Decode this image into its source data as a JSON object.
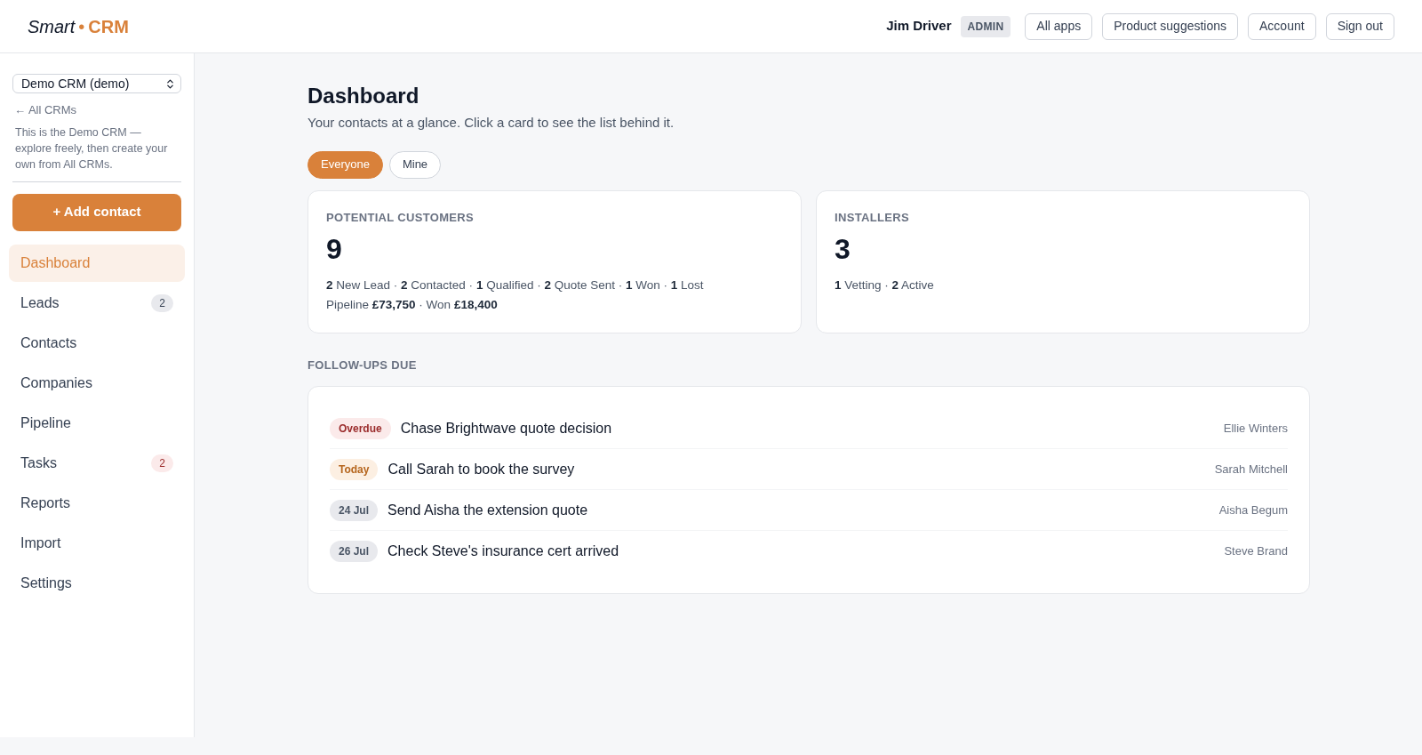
{
  "header": {
    "logo": {
      "prefix": "Smart",
      "separator": "•",
      "suffix": "CRM"
    },
    "user_name": "Jim Driver",
    "role_badge": "ADMIN",
    "buttons": [
      "All apps",
      "Product suggestions",
      "Account",
      "Sign out"
    ]
  },
  "sidebar": {
    "crm_select": {
      "value": "Demo CRM (demo)"
    },
    "back_link": "← All CRMs",
    "note": "This is the Demo CRM — explore freely, then create your own from All CRMs.",
    "add_button": "+ Add contact",
    "nav": [
      {
        "label": "Dashboard",
        "selected": true
      },
      {
        "label": "Leads",
        "selected": false,
        "badge": {
          "text": "2",
          "kind": "neutral"
        }
      },
      {
        "label": "Contacts",
        "selected": false
      },
      {
        "label": "Companies",
        "selected": false
      },
      {
        "label": "Pipeline",
        "selected": false
      },
      {
        "label": "Tasks",
        "selected": false,
        "badge": {
          "text": "2",
          "kind": "alert"
        }
      },
      {
        "label": "Reports",
        "selected": false
      },
      {
        "label": "Import",
        "selected": false
      },
      {
        "label": "Settings",
        "selected": false
      }
    ]
  },
  "main": {
    "title": "Dashboard",
    "subtitle": "Your contacts at a glance. Click a card to see the list behind it.",
    "filters": [
      {
        "label": "Everyone",
        "selected": true
      },
      {
        "label": "Mine",
        "selected": false
      }
    ],
    "cards": [
      {
        "title": "POTENTIAL CUSTOMERS",
        "count": "9",
        "lines": [
          "**2** New Lead · **2** Contacted · **1** Qualified · **2** Quote Sent · **1** Won · **1** Lost",
          "Pipeline **£73,750** · Won **£18,400**"
        ]
      },
      {
        "title": "INSTALLERS",
        "count": "3",
        "lines": [
          "**1** Vetting · **2** Active"
        ]
      }
    ],
    "followups": {
      "heading": "FOLLOW-UPS DUE",
      "items": [
        {
          "due": "Overdue",
          "kind": "overdue",
          "task": "Chase Brightwave quote decision",
          "contact": "Ellie Winters"
        },
        {
          "due": "Today",
          "kind": "today",
          "task": "Call Sarah to book the survey",
          "contact": "Sarah Mitchell"
        },
        {
          "due": "24 Jul",
          "kind": "date",
          "task": "Send Aisha the extension quote",
          "contact": "Aisha Begum"
        },
        {
          "due": "26 Jul",
          "kind": "date",
          "task": "Check Steve's insurance cert arrived",
          "contact": "Steve Brand"
        }
      ]
    }
  }
}
